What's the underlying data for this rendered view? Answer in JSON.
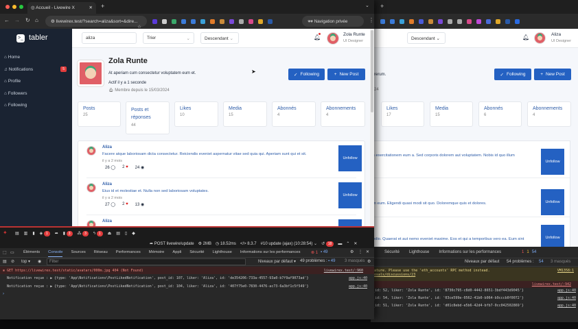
{
  "front": {
    "tab_title": "Accueil - Livewire X",
    "url": "livewirex.test/?search=aliza&sort=&dire...",
    "private_label": "Navigation privée",
    "logo": "tabler",
    "sidebar": [
      {
        "label": "Home"
      },
      {
        "label": "Notifications",
        "badge": "5"
      },
      {
        "label": "Profile"
      },
      {
        "label": "Followers"
      },
      {
        "label": "Following"
      }
    ],
    "search_value": "aliza",
    "sort_label": "Trier",
    "direction_label": "Descendant",
    "user": {
      "name": "Zola Runte",
      "role": "UI Designer"
    },
    "profile": {
      "name": "Zola Runte",
      "bio": "At aperiam cum consectetur voluptatem eum et.",
      "active": "Actif il y a 1 seconde",
      "member_since": "Membre depuis le 15/03/2024"
    },
    "following_label": "Following",
    "new_post_label": "New Post",
    "stats": [
      {
        "label": "Posts",
        "value": "25"
      },
      {
        "label": "Posts et réponses",
        "value": "44"
      },
      {
        "label": "Likes",
        "value": "10"
      },
      {
        "label": "Media",
        "value": "15"
      },
      {
        "label": "Abonnés",
        "value": "4"
      },
      {
        "label": "Abonnements",
        "value": "4"
      }
    ],
    "posts": [
      {
        "author": "Aliza",
        "text": "Facere atque laboriosam dicta consectetur. Reiciendis eveniet aspernatur vitae sed quia qui. Aperiam sunt qui et sit.",
        "time": "il y a 2 mois",
        "comments": "26",
        "likes": "2",
        "views": "24"
      },
      {
        "author": "Aliza",
        "text": "Eius id et molestiae et. Nulla non sed laboriosam voluptates.",
        "time": "il y a 2 mois",
        "comments": "27",
        "likes": "2",
        "views": "13"
      },
      {
        "author": "Aliza"
      }
    ],
    "unfollow_label": "Unfollow",
    "debugbar": {
      "badges": [
        "1",
        "3",
        "3",
        "1"
      ],
      "request": "POST livewire/update",
      "memory": "2MB",
      "time": "18.52ms",
      "php": "8.3.7",
      "update": "#10 update (ajax) (10:28:54)",
      "count": "18"
    },
    "devtools": {
      "tabs": [
        "Éléments",
        "Console",
        "Sources",
        "Réseau",
        "Performances",
        "Mémoire",
        "Appli",
        "Sécurité",
        "Lighthouse",
        "Informations sur les performances"
      ],
      "active_tab": "Console",
      "errors": "1",
      "messages": "49",
      "context": "top",
      "filter_placeholder": "Filter",
      "levels": "Niveaux par défaut",
      "problems": "49 problèmes :",
      "problems_count": "49",
      "hidden": "3 masqués",
      "logs": [
        {
          "text": "GET https://livewirex.test/static/avatars/000m.jpg 404 (Not Found)",
          "source": "livewirex.test/:960",
          "type": "error"
        },
        {
          "text": "Notification reçue :  ▶ {type: 'App\\Notifications\\PostLikedNotification', post_id: 107, liker: 'Aliza', id: 'de354206-733a-4557-93a0-b7f9af9073ad'}",
          "source": "app.js:40"
        },
        {
          "text": "Notification reçue :  ▶ {type: 'App\\Notifications\\PostLikedNotification', post_id: 104, liker: 'Aliza', id: '407f75e0-7830-4476-ac73-6a3bf1c5f549'}",
          "source": "app.js:40"
        }
      ]
    }
  },
  "back": {
    "direction_label": "Descendant",
    "user": {
      "name": "Aliza",
      "role": "UI Designer"
    },
    "bio_tail": "o rerum.",
    "member_tail": "24",
    "following_label": "Following",
    "new_post_label": "New Post",
    "stats": [
      {
        "label": "Likes",
        "value": "17"
      },
      {
        "label": "Media",
        "value": "15"
      },
      {
        "label": "Abonnés",
        "value": "6"
      },
      {
        "label": "Abonnements",
        "value": "4"
      }
    ],
    "posts": [
      "s exercitationem eum a. Sed corporis dolorem aut voluptatem. Nobis id quo illum",
      "m eum. Eligendi quasi modi sit quo. Doloremque quis et dolores.",
      "odio. Quaerat et aut nemo eveniet maxime. Eos et qui a temporibus vero ea. Eum sint"
    ],
    "unfollow_label": "Unfollow",
    "devtools": {
      "tabs": [
        "Sécurité",
        "Lighthouse",
        "Informations sur les performances"
      ],
      "errors": "1",
      "warnings": "1",
      "messages": "54",
      "levels": "Niveaux par défaut",
      "problems": "54 problèmes :",
      "problems_count": "54",
      "hidden": "3 masqués",
      "warning": "ature. Please use the 'eth_accounts' RPC method instead.",
      "warning_link": "osals/discussions/23",
      "warning_source": "VM1358:1",
      "error_source": "livewirex.test/:942",
      "logs": [
        {
          "text": "_id: 52, liker: 'Zola Runte', id: '8730c795-c8d0-4442-8651-3bdf443d9045'}",
          "source": "app.js:40"
        },
        {
          "text": "_id: 54, liker: 'Zola Runte', id: '03ce599e-0562-41b0-b064-b9cccb0f0072'}",
          "source": "app.js:40"
        },
        {
          "text": "_id: 51, liker: 'Zola Runte', id: 'd01c8ebd-e5b6-42d4-bfb7-0cc042502869'}",
          "source": "app.js:40"
        }
      ]
    }
  },
  "colors": {
    "primary": "#2461c2",
    "sidebar": "#1a2332",
    "danger": "#e23c3c"
  }
}
